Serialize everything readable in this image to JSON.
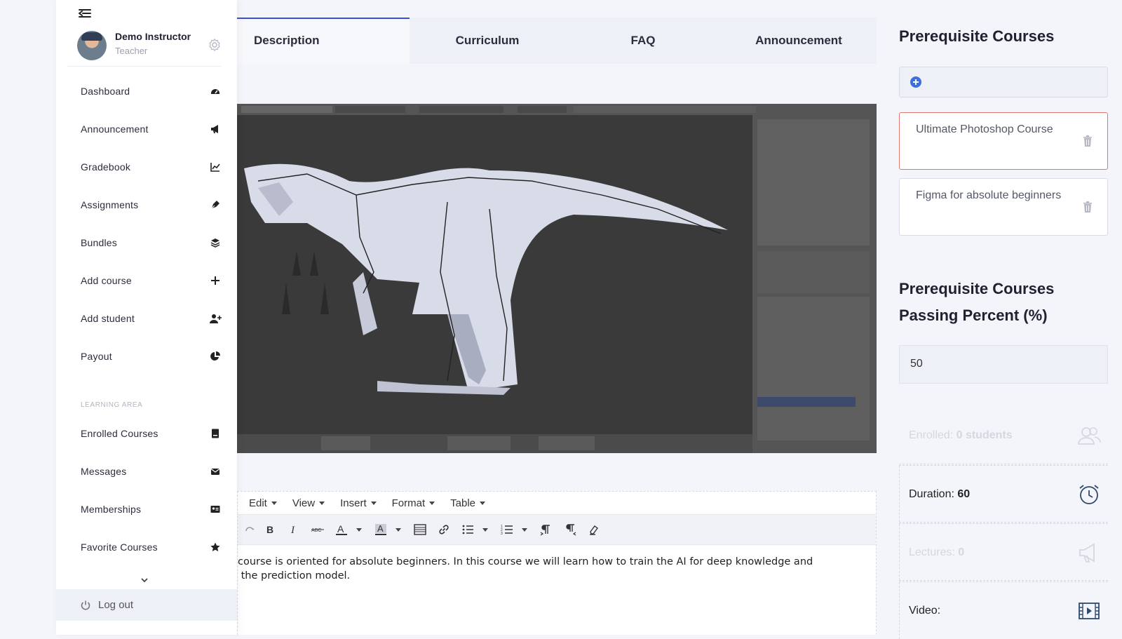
{
  "sidebar": {
    "profile": {
      "name": "Demo Instructor",
      "role": "Teacher"
    },
    "items": [
      {
        "label": "Dashboard",
        "icon": "dashboard-icon"
      },
      {
        "label": "Announcement",
        "icon": "megaphone-icon"
      },
      {
        "label": "Gradebook",
        "icon": "chart-line-icon"
      },
      {
        "label": "Assignments",
        "icon": "pen-icon"
      },
      {
        "label": "Bundles",
        "icon": "layers-icon"
      },
      {
        "label": "Add course",
        "icon": "plus-icon"
      },
      {
        "label": "Add student",
        "icon": "user-plus-icon"
      },
      {
        "label": "Payout",
        "icon": "pie-chart-icon"
      }
    ],
    "learning_section_label": "LEARNING AREA",
    "learning_items": [
      {
        "label": "Enrolled Courses",
        "icon": "book-icon"
      },
      {
        "label": "Messages",
        "icon": "envelope-icon"
      },
      {
        "label": "Memberships",
        "icon": "id-card-icon"
      },
      {
        "label": "Favorite Courses",
        "icon": "star-icon"
      }
    ],
    "logout_label": "Log out"
  },
  "tabs": [
    {
      "label": "Description",
      "active": true
    },
    {
      "label": "Curriculum",
      "active": false
    },
    {
      "label": "FAQ",
      "active": false
    },
    {
      "label": "Announcement",
      "active": false
    }
  ],
  "editor": {
    "menus": [
      "Edit",
      "View",
      "Insert",
      "Format",
      "Table"
    ],
    "toolbar_icons": [
      "redo-icon",
      "bold-icon",
      "italic-icon",
      "strikethrough-icon",
      "text-color-icon",
      "background-color-icon",
      "horizontal-rule-icon",
      "link-icon",
      "bullet-list-icon",
      "numbered-list-icon",
      "ltr-icon",
      "rtl-icon",
      "clear-format-icon"
    ],
    "content_line1": "course is oriented for absolute beginners. In this course we will learn how to train the AI for deep knowledge and",
    "content_line2": " the prediction model."
  },
  "right": {
    "prereq_heading": "Prerequisite Courses",
    "prereq_courses": [
      {
        "title": "Ultimate Photoshop Course",
        "selected": true
      },
      {
        "title": "Figma for absolute beginners",
        "selected": false
      }
    ],
    "passing_heading_line1": "Prerequisite Courses",
    "passing_heading_line2": "Passing Percent (%)",
    "passing_value": "50",
    "stats": {
      "enrolled_label": "Enrolled:",
      "enrolled_value": "0 students",
      "duration_label": "Duration:",
      "duration_value": "60",
      "lectures_label": "Lectures:",
      "lectures_value": "0",
      "video_label": "Video:"
    }
  },
  "colors": {
    "accent": "#3b4fd8",
    "selected_border": "#e0776e",
    "add_icon": "#3f6fd8"
  }
}
